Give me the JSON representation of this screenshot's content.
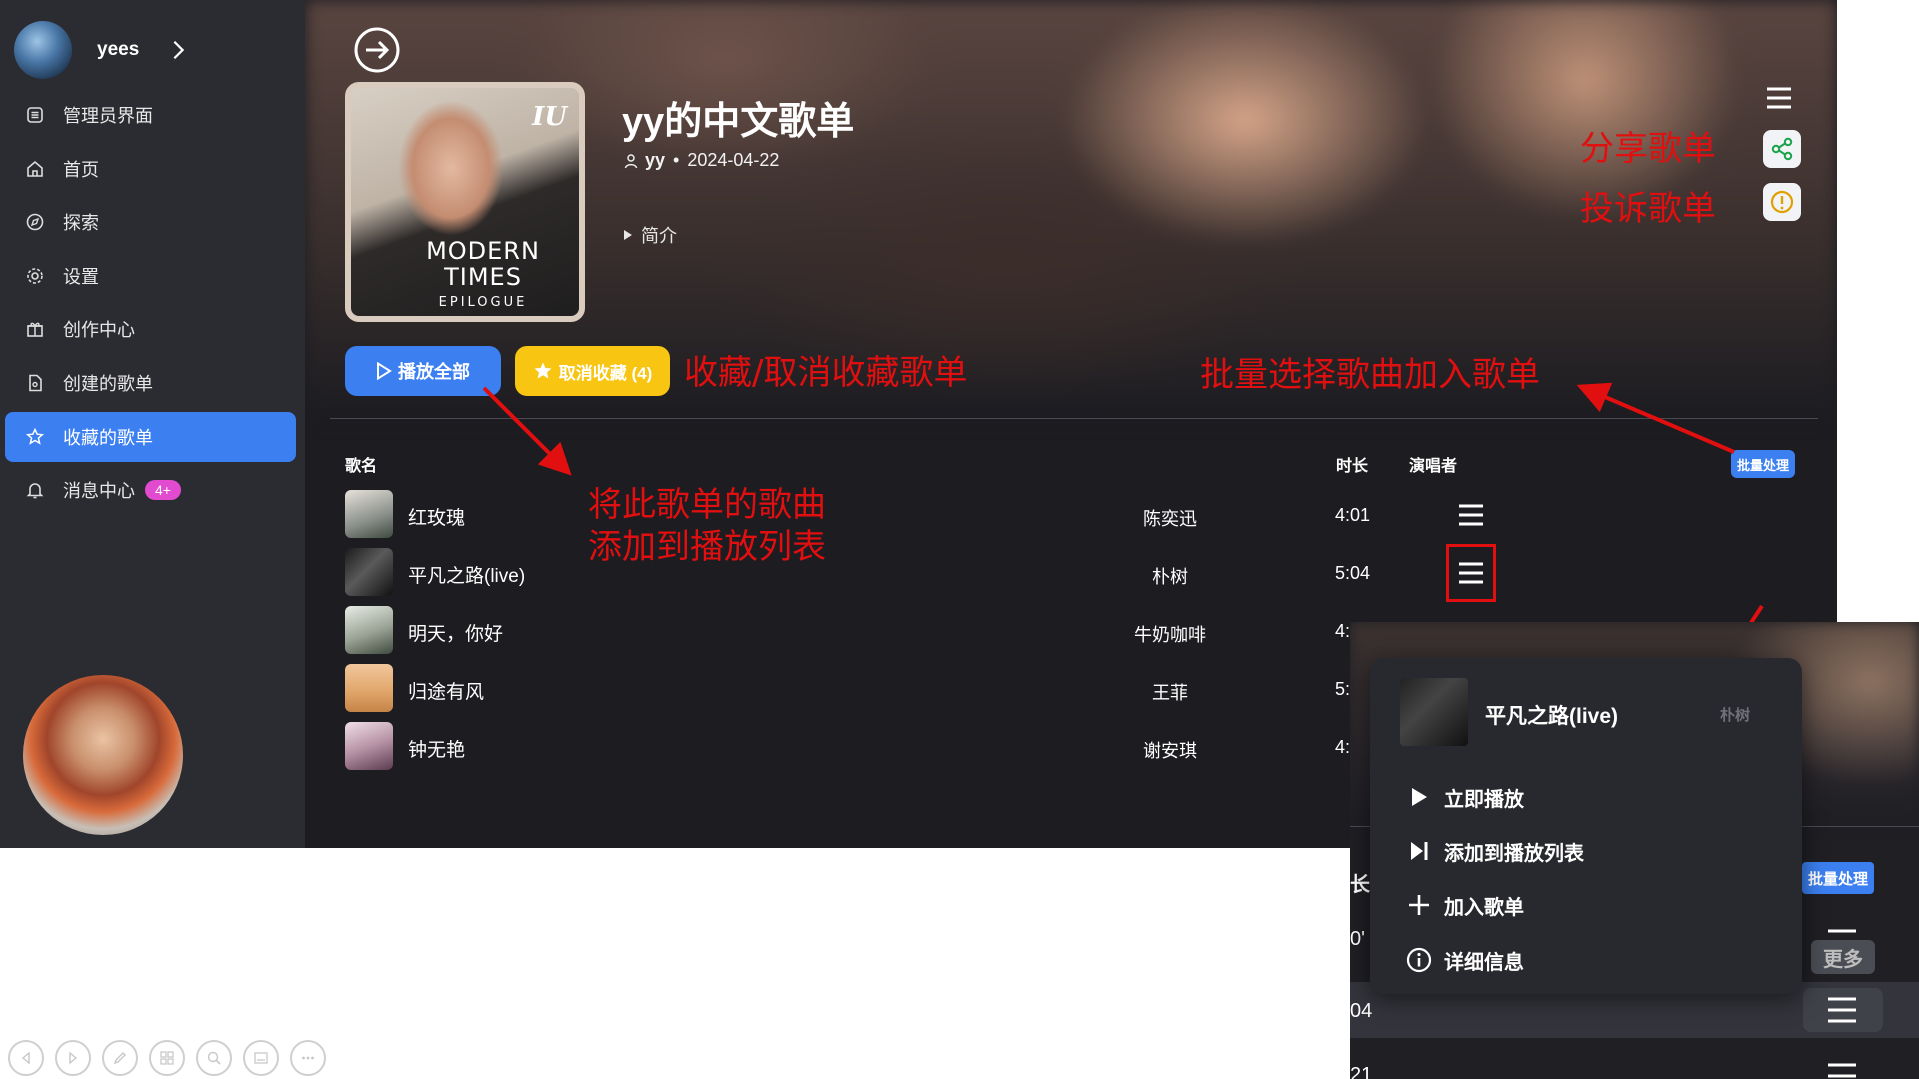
{
  "sidebar": {
    "user": {
      "name": "yees"
    },
    "items": [
      {
        "label": "管理员界面",
        "icon": "admin-icon"
      },
      {
        "label": "首页",
        "icon": "home-icon"
      },
      {
        "label": "探索",
        "icon": "compass-icon"
      },
      {
        "label": "设置",
        "icon": "gear-icon"
      },
      {
        "label": "创作中心",
        "icon": "gift-icon"
      },
      {
        "label": "创建的歌单",
        "icon": "document-icon"
      },
      {
        "label": "收藏的歌单",
        "icon": "star-icon",
        "active": true
      },
      {
        "label": "消息中心",
        "icon": "bell-icon",
        "badge": "4+"
      }
    ]
  },
  "playlist": {
    "title": "yy的中文歌单",
    "owner": "yy",
    "date": "2024-04-22",
    "intro_label": "简介",
    "cover": {
      "logo": "IU",
      "line1": "MODERN",
      "line2": "TIMES",
      "line3": "EPILOGUE"
    }
  },
  "actions": {
    "play_all": "播放全部",
    "unfavorite": "取消收藏 (4)"
  },
  "table": {
    "headers": {
      "name": "歌名",
      "singer": "演唱者",
      "duration": "时长"
    },
    "batch_label": "批量处理",
    "rows": [
      {
        "name": "红玫瑰",
        "singer": "陈奕迅",
        "duration": "4:01"
      },
      {
        "name": "平凡之路(live)",
        "singer": "朴树",
        "duration": "5:04"
      },
      {
        "name": "明天，你好",
        "singer": "牛奶咖啡",
        "duration": "4:"
      },
      {
        "name": "归途有风",
        "singer": "王菲",
        "duration": "5:"
      },
      {
        "name": "钟无艳",
        "singer": "谢安琪",
        "duration": "4:"
      }
    ]
  },
  "annotations": {
    "share": "分享歌单",
    "report": "投诉歌单",
    "fav": "收藏/取消收藏歌单",
    "batch": "批量选择歌曲加入歌单",
    "add_line1": "将此歌单的歌曲",
    "add_line2": "添加到播放列表"
  },
  "zoom": {
    "header_partial": "长",
    "batch_label": "批量处理",
    "dur1": "0'",
    "dur2": "04",
    "dur3": "21",
    "more_tooltip": "更多",
    "menu": {
      "song": "平凡之路(live)",
      "singer": "朴树",
      "items": [
        {
          "label": "立即播放",
          "icon": "play-icon"
        },
        {
          "label": "添加到播放列表",
          "icon": "play-next-icon"
        },
        {
          "label": "加入歌单",
          "icon": "plus-icon"
        },
        {
          "label": "详细信息",
          "icon": "info-icon"
        }
      ]
    }
  },
  "colors": {
    "accent_blue": "#3b7ff0",
    "fav_yellow": "#f7c512",
    "annotation_red": "#e10f0f",
    "badge_pink": "#e24bd0",
    "sidebar_bg": "#2b2c31",
    "main_bg": "#1c1c21"
  }
}
